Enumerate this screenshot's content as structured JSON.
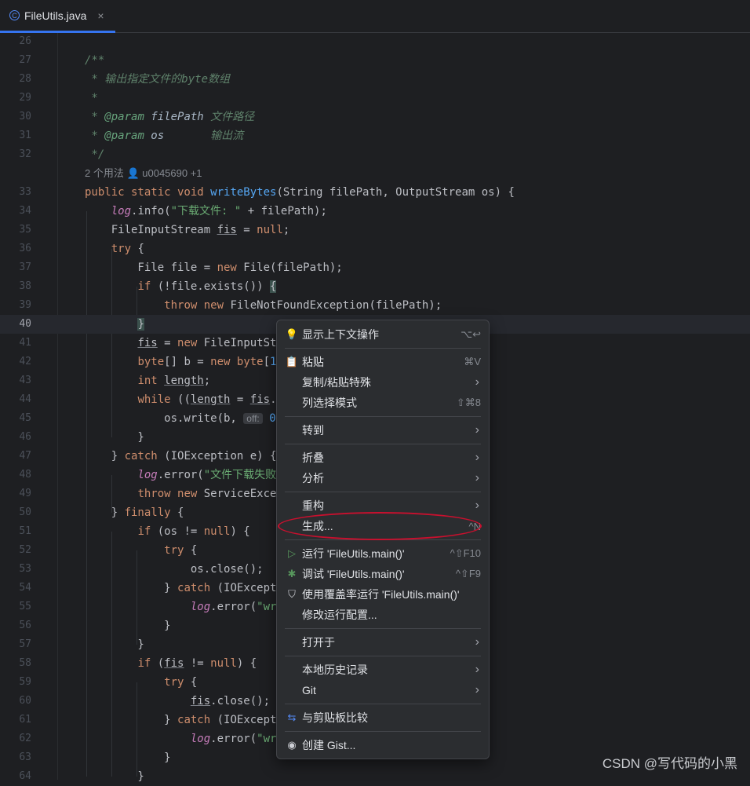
{
  "tab": {
    "filename": "FileUtils.java",
    "close": "×",
    "icon": "class-icon"
  },
  "editor": {
    "inlay_hint": "2 个用法   👤 u0045690 +1",
    "lines": {
      "l26": "26",
      "l27": "27",
      "l28": "28",
      "l29": "29",
      "l30": "30",
      "l31": "31",
      "l32": "32",
      "l33": "33",
      "l34": "34",
      "l35": "35",
      "l36": "36",
      "l37": "37",
      "l38": "38",
      "l39": "39",
      "l40": "40",
      "l41": "41",
      "l42": "42",
      "l43": "43",
      "l44": "44",
      "l45": "45",
      "l46": "46",
      "l47": "47",
      "l48": "48",
      "l49": "49",
      "l50": "50",
      "l51": "51",
      "l52": "52",
      "l53": "53",
      "l54": "54",
      "l55": "55",
      "l56": "56",
      "l57": "57",
      "l58": "58",
      "l59": "59",
      "l60": "60",
      "l61": "61",
      "l62": "62",
      "l63": "63",
      "l64": "64"
    }
  },
  "menu": {
    "items": [
      {
        "label": "显示上下文操作",
        "shortcut": "⌥↩",
        "icon": "lightbulb-icon"
      },
      {
        "label": "粘贴",
        "shortcut": "⌘V",
        "icon": "clipboard-icon"
      },
      {
        "label": "复制/粘贴特殊",
        "arrow": "›"
      },
      {
        "label": "列选择模式",
        "shortcut": "⇧⌘8"
      },
      {
        "label": "转到",
        "arrow": "›"
      },
      {
        "label": "折叠",
        "arrow": "›"
      },
      {
        "label": "分析",
        "arrow": "›"
      },
      {
        "label": "重构",
        "arrow": "›"
      },
      {
        "label": "生成...",
        "shortcut": "^N"
      },
      {
        "label": "运行 'FileUtils.main()'",
        "shortcut": "^⇧F10",
        "icon": "run-icon"
      },
      {
        "label": "调试 'FileUtils.main()'",
        "shortcut": "^⇧F9",
        "icon": "debug-icon"
      },
      {
        "label": "使用覆盖率运行 'FileUtils.main()'",
        "icon": "coverage-icon"
      },
      {
        "label": "修改运行配置..."
      },
      {
        "label": "打开于",
        "arrow": "›"
      },
      {
        "label": "本地历史记录",
        "arrow": "›"
      },
      {
        "label": "Git",
        "arrow": "›"
      },
      {
        "label": "与剪贴板比较",
        "icon": "compare-icon"
      },
      {
        "label": "创建 Gist...",
        "icon": "github-icon"
      }
    ]
  },
  "watermark": "CSDN @写代码的小黑",
  "colors": {
    "background": "#1e1f22",
    "menu_bg": "#2b2d30",
    "accent": "#3574f0",
    "annotation": "#c8102e"
  }
}
